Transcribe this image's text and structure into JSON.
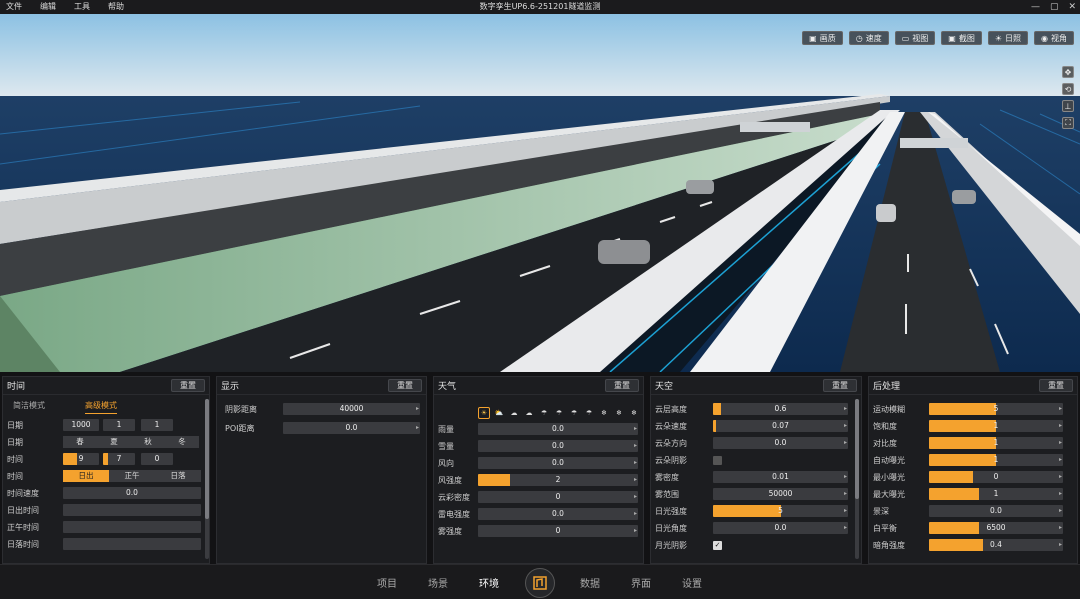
{
  "menu": [
    "文件",
    "编辑",
    "工具",
    "帮助"
  ],
  "window_title": "数字孪生UP6.6-251201隧道监测",
  "window_controls": [
    "—",
    "▢",
    "✕"
  ],
  "toolbar": [
    {
      "icon": "▣",
      "label": "画质"
    },
    {
      "icon": "◷",
      "label": "速度"
    },
    {
      "icon": "▭",
      "label": "视图"
    },
    {
      "icon": "▣",
      "label": "截图"
    },
    {
      "icon": "☀",
      "label": "日照"
    },
    {
      "icon": "◉",
      "label": "视角"
    }
  ],
  "side_tools": [
    "✥",
    "⟲",
    "⊥",
    "⛶"
  ],
  "panels": {
    "time": {
      "title": "时间",
      "reset": "重置",
      "tabs": [
        "简洁模式",
        "高级模式"
      ],
      "rows": [
        {
          "label": "日期",
          "values": [
            "1000",
            "1",
            "1"
          ]
        },
        {
          "label": "日期",
          "segments": [
            "春",
            "夏",
            "秋",
            "冬"
          ]
        },
        {
          "label": "时间",
          "values": [
            "9",
            "7",
            "0"
          ]
        },
        {
          "label": "时间",
          "segments": [
            "日出",
            "正午",
            "日落"
          ]
        },
        {
          "label": "时间速度",
          "value": "0.0"
        },
        {
          "label": "日出时间",
          "value": ""
        },
        {
          "label": "正午时间",
          "value": ""
        },
        {
          "label": "日落时间",
          "value": ""
        }
      ]
    },
    "display": {
      "title": "显示",
      "reset": "重置",
      "rows": [
        {
          "label": "阴影距离",
          "value": "40000"
        },
        {
          "label": "POI距离",
          "value": "0.0"
        }
      ]
    },
    "weather": {
      "title": "天气",
      "reset": "重置",
      "icons": [
        "☀",
        "⛅",
        "☁",
        "☁",
        "☂",
        "☂",
        "☂",
        "☂",
        "❄",
        "❄",
        "❄"
      ],
      "rows": [
        {
          "label": "雨量",
          "value": "0.0",
          "fill": 0
        },
        {
          "label": "雪量",
          "value": "0.0",
          "fill": 0
        },
        {
          "label": "风向",
          "value": "0.0",
          "fill": 0
        },
        {
          "label": "风强度",
          "value": "2",
          "fill": 0.2
        },
        {
          "label": "云彩密度",
          "value": "0",
          "fill": 0
        },
        {
          "label": "雷电强度",
          "value": "0.0",
          "fill": 0
        },
        {
          "label": "雾强度",
          "value": "0",
          "fill": 0
        }
      ]
    },
    "sky": {
      "title": "天空",
      "reset": "重置",
      "rows": [
        {
          "label": "云层高度",
          "value": "0.6",
          "fill": 0.06
        },
        {
          "label": "云朵速度",
          "value": "0.07",
          "fill": 0.02
        },
        {
          "label": "云朵方向",
          "value": "0.0",
          "fill": 0
        },
        {
          "label": "云朵阴影",
          "check": false
        },
        {
          "label": "雾密度",
          "value": "0.01",
          "fill": 0
        },
        {
          "label": "雾范围",
          "value": "50000",
          "fill": 0
        },
        {
          "label": "日光强度",
          "value": "5",
          "fill": 0.5
        },
        {
          "label": "日光角度",
          "value": "0.0",
          "fill": 0
        },
        {
          "label": "月光阴影",
          "check": true
        }
      ]
    },
    "post": {
      "title": "后处理",
      "reset": "重置",
      "rows": [
        {
          "label": "运动模糊",
          "value": "5",
          "fill": 0.5
        },
        {
          "label": "饱和度",
          "value": "1",
          "fill": 0.5
        },
        {
          "label": "对比度",
          "value": "1",
          "fill": 0.5
        },
        {
          "label": "自动曝光",
          "value": "1",
          "fill": 0.5
        },
        {
          "label": "最小曝光",
          "value": "0",
          "fill": 0.33
        },
        {
          "label": "最大曝光",
          "value": "1",
          "fill": 0.37
        },
        {
          "label": "景深",
          "value": "0.0",
          "fill": 0
        },
        {
          "label": "白平衡",
          "value": "6500",
          "fill": 0.37
        },
        {
          "label": "暗角强度",
          "value": "0.4",
          "fill": 0.4
        }
      ]
    }
  },
  "bottom_nav": [
    "项目",
    "场景",
    "环境",
    "数据",
    "界面",
    "设置"
  ],
  "bottom_nav_active": "环境",
  "colors": {
    "accent": "#f4a22e",
    "panel": "#1c1d20",
    "field": "#3a3b3f"
  }
}
